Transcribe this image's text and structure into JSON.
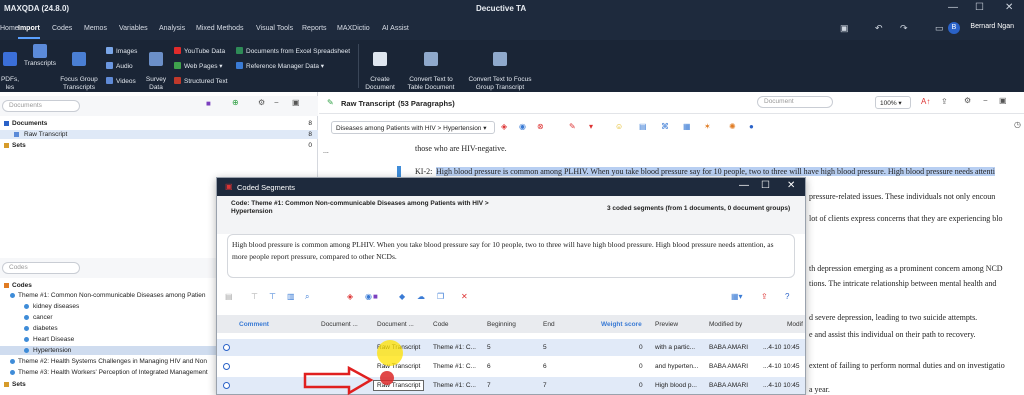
{
  "app": {
    "title": "MAXQDA (24.8.0)",
    "window_title": "Decuctive TA"
  },
  "menu": {
    "tabs": [
      "Home",
      "Import",
      "Codes",
      "Memos",
      "Variables",
      "Analysis",
      "Mixed Methods",
      "Visual Tools",
      "Reports",
      "MAXDictio",
      "AI Assist"
    ],
    "active_tab": "Import",
    "user_initial": "B",
    "user_name": "Bernard Ngan"
  },
  "ribbon": {
    "pdfs": "PDFs,\nles",
    "transcripts": "Transcripts",
    "focus_group": "Focus Group\nTranscripts",
    "images": "Images",
    "audio": "Audio",
    "videos": "Videos",
    "survey": "Survey\nData",
    "youtube": "YouTube Data",
    "webpages": "Web Pages",
    "structured": "Structured Text",
    "excel": "Documents from Excel Spreadsheet",
    "refmanager": "Reference Manager Data",
    "create_doc": "Create\nDocument",
    "convert_table": "Convert Text to\nTable Document",
    "convert_focus": "Convert Text to Focus\nGroup Transcript"
  },
  "left": {
    "doc_search_placeholder": "Documents",
    "documents_label": "Documents",
    "documents_count": "8",
    "raw_transcript": "Raw Transcript",
    "raw_count": "8",
    "sets_label": "Sets",
    "sets_count": "0",
    "code_search_placeholder": "Codes",
    "codes_label": "Codes",
    "theme1": "Theme #1: Common Non-communicable Diseases among Patien",
    "code_items": [
      "kidney diseases",
      "cancer",
      "diabetes",
      "Heart Disease",
      "Hypertension"
    ],
    "theme2": "Theme #2: Health Systems Challenges in Managing HIV  and Non",
    "theme3": "Theme #3: Health Workers' Perception of Integrated Management",
    "sets2": "Sets"
  },
  "document": {
    "title": "Raw Transcript",
    "paragraphs": "(53 Paragraphs)",
    "search_placeholder": "Document",
    "zoom": "100%",
    "code_filter": "Diseases among Patients with HIV > Hypertension",
    "ellipsis": "...",
    "line0": "those who are HIV-negative.",
    "speaker": "KI-2:",
    "line1": "High blood pressure is common among PLHIV. When you take blood pressure say for 10 people, two to three will have high blood pressure. High blood pressure needs attenti",
    "right_lines": [
      "pressure-related issues. These individuals not only encoun",
      "lot of clients express concerns that they are experiencing blo",
      "th depression emerging as a prominent concern among NCD",
      "tions. The intricate relationship between mental health and",
      "d severe depression, leading to two suicide attempts.",
      "e and assist this individual on their path to recovery.",
      "extent of failing to perform normal duties and on investigatio",
      "a year."
    ]
  },
  "dialog": {
    "title": "Coded Segments",
    "code_path": "Code: Theme #1: Common Non-communicable Diseases among Patients with HIV > Hypertension",
    "summary": "3 coded segments (from 1 documents, 0 document groups)",
    "segment_text": "High blood pressure is common among PLHIV. When you take blood pressure say for 10 people, two to three will have high blood pressure. High blood pressure needs attention, as more people report pressure, compared to other NCDs.",
    "columns": [
      "Comment",
      "Document ...",
      "Document ...",
      "Code",
      "Beginning",
      "End",
      "Weight score",
      "Preview",
      "Modified by",
      "Modif"
    ],
    "rows": [
      {
        "doc": "Raw Transcript",
        "code": "Theme #1: C...",
        "begin": "5",
        "end": "5",
        "weight": "0",
        "preview": "with a partic...",
        "modified_by": "BABA  AMARI",
        "modified": "...4-10 10:45"
      },
      {
        "doc": "Raw Transcript",
        "code": "Theme #1: C...",
        "begin": "6",
        "end": "6",
        "weight": "0",
        "preview": "and hyperten...",
        "modified_by": "BABA  AMARI",
        "modified": "...4-10 10:45"
      },
      {
        "doc": "Raw Transcript",
        "code": "Theme #1: C...",
        "begin": "7",
        "end": "7",
        "weight": "0",
        "preview": "High blood p...",
        "modified_by": "BABA  AMARI",
        "modified": "...4-10 10:45"
      }
    ]
  },
  "colors": {
    "titlebar": "#1e2a3d",
    "accent": "#2a62c8",
    "highlight": "#b8cff2",
    "arrow": "#e02020"
  }
}
